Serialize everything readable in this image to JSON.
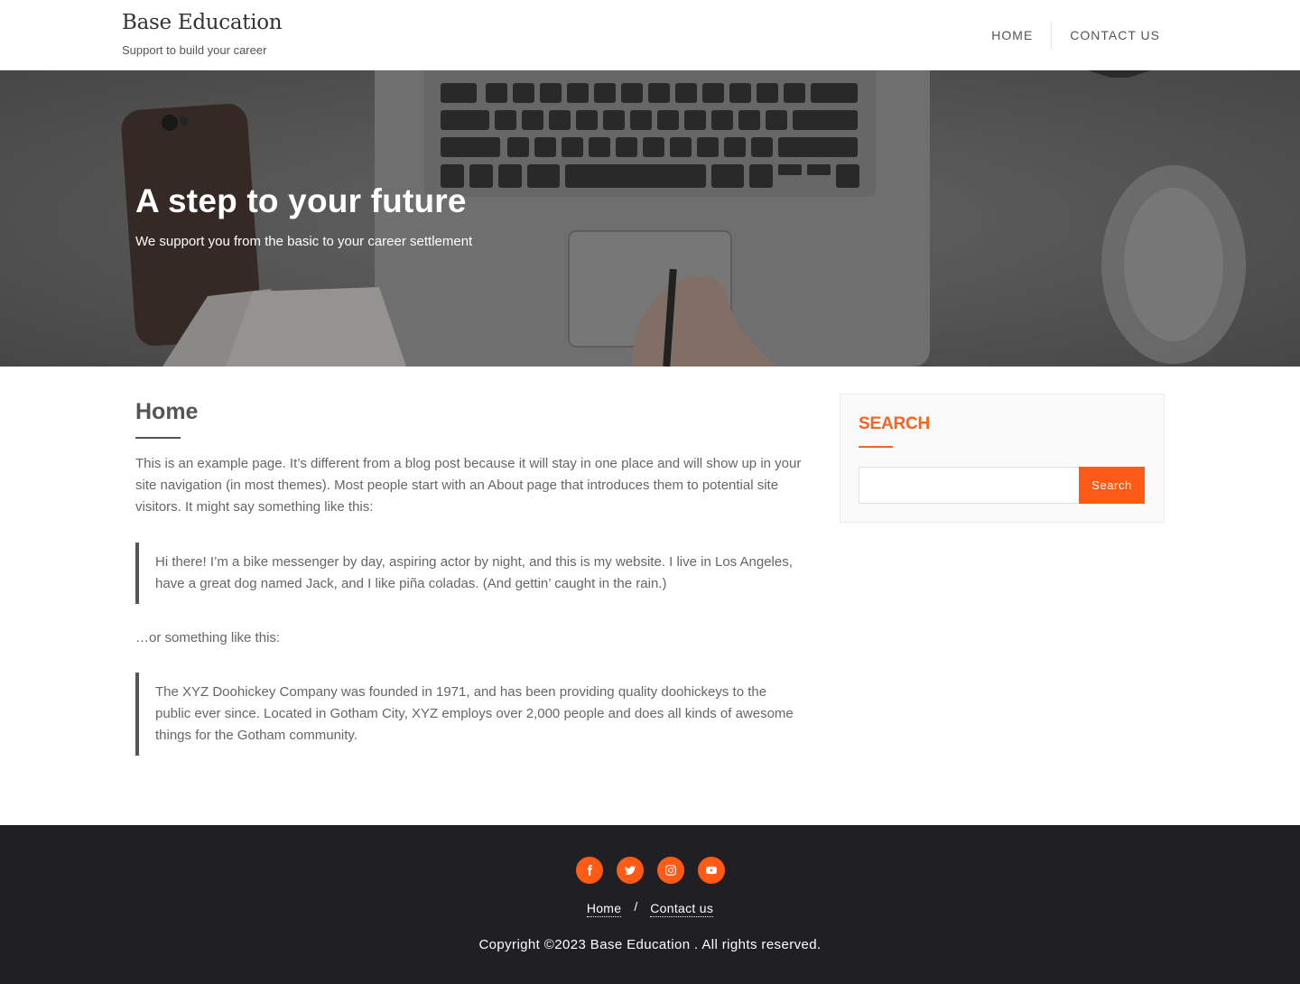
{
  "header": {
    "site_title": "Base Education",
    "tagline": "Support to build your career",
    "nav": [
      {
        "label": "Home"
      },
      {
        "label": "Contact us"
      }
    ]
  },
  "hero": {
    "title": "A step to your future",
    "subtitle": "We support you from the basic to your career settlement"
  },
  "main": {
    "page_title": "Home",
    "intro": "This is an example page. It’s different from a blog post because it will stay in one place and will show up in your site navigation (in most themes). Most people start with an About page that introduces them to potential site visitors. It might say something like this:",
    "quote1": "Hi there! I’m a bike messenger by day, aspiring actor by night, and this is my website. I live in Los Angeles, have a great dog named Jack, and I like piña coladas. (And gettin’ caught in the rain.)",
    "middle": "…or something like this:",
    "quote2": "The XYZ Doohickey Company was founded in 1971, and has been providing quality doohickeys to the public ever since. Located in Gotham City, XYZ employs over 2,000 people and does all kinds of awesome things for the Gotham community."
  },
  "sidebar": {
    "widget_title": "Search",
    "search_value": "",
    "search_button": "Search"
  },
  "footer": {
    "social": [
      "facebook-icon",
      "twitter-icon",
      "instagram-icon",
      "youtube-icon"
    ],
    "links": [
      {
        "label": "Home"
      },
      {
        "label": "Contact us"
      }
    ],
    "separator": "/",
    "copyright": "Copyright ©2023 Base Education . All rights reserved."
  },
  "colors": {
    "accent": "#ff5b16",
    "footer_bg": "#202024",
    "text": "#666666"
  }
}
